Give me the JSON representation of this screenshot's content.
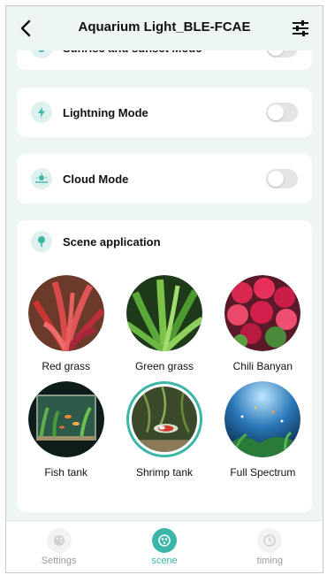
{
  "header": {
    "title": "Aquarium Light_BLE-FCAE"
  },
  "modes": [
    {
      "label": "Sunrise and sunset Mode",
      "enabled": false
    },
    {
      "label": "Lightning Mode",
      "enabled": false
    },
    {
      "label": "Cloud Mode",
      "enabled": false
    }
  ],
  "scene": {
    "title": "Scene application",
    "items": [
      {
        "label": "Red grass",
        "selected": false
      },
      {
        "label": "Green grass",
        "selected": false
      },
      {
        "label": "Chili Banyan",
        "selected": false
      },
      {
        "label": "Fish tank",
        "selected": false
      },
      {
        "label": "Shrimp tank",
        "selected": true
      },
      {
        "label": "Full Spectrum",
        "selected": false
      }
    ]
  },
  "tabs": [
    {
      "label": "Settings",
      "active": false
    },
    {
      "label": "scene",
      "active": true
    },
    {
      "label": "timing",
      "active": false
    }
  ],
  "colors": {
    "accent": "#3bb6a7",
    "background": "#eef6f5",
    "inactive": "#9a9a9a"
  }
}
